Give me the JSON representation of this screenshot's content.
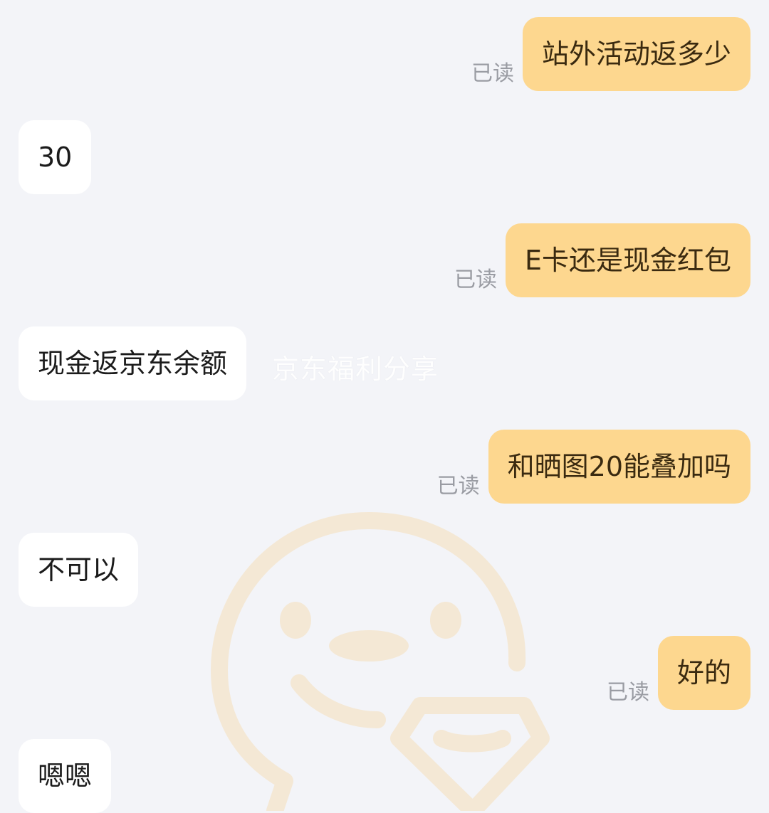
{
  "watermark": {
    "text": "京东福利分享",
    "mascot_icon": "jd-joy-mascot-icon",
    "color": "#f7c97a"
  },
  "colors": {
    "background": "#f3f4f8",
    "outgoing_bubble": "#fdd78f",
    "incoming_bubble": "#ffffff",
    "read_receipt": "#9a9ca3"
  },
  "messages": [
    {
      "direction": "outgoing",
      "text": "站外活动返多少",
      "status": "已读"
    },
    {
      "direction": "incoming",
      "text": "30"
    },
    {
      "direction": "outgoing",
      "text": "E卡还是现金红包",
      "status": "已读"
    },
    {
      "direction": "incoming",
      "text": "现金返京东余额"
    },
    {
      "direction": "outgoing",
      "text": "和晒图20能叠加吗",
      "status": "已读"
    },
    {
      "direction": "incoming",
      "text": "不可以"
    },
    {
      "direction": "outgoing",
      "text": "好的",
      "status": "已读"
    },
    {
      "direction": "incoming",
      "text": "嗯嗯"
    }
  ]
}
